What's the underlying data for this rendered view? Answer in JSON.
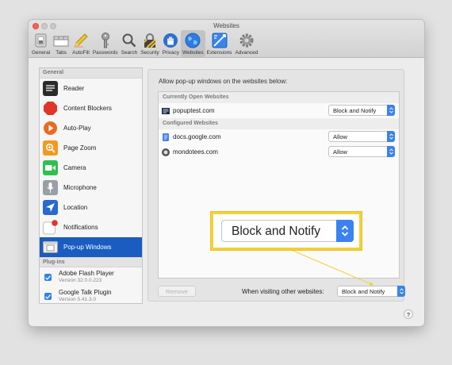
{
  "window": {
    "title": "Websites"
  },
  "toolbar": {
    "items": [
      {
        "label": "General",
        "icon": "switch-icon"
      },
      {
        "label": "Tabs",
        "icon": "tabs-icon"
      },
      {
        "label": "AutoFill",
        "icon": "pencil-icon"
      },
      {
        "label": "Passwords",
        "icon": "key-icon"
      },
      {
        "label": "Search",
        "icon": "magnifier-icon"
      },
      {
        "label": "Security",
        "icon": "padlock-icon"
      },
      {
        "label": "Privacy",
        "icon": "hand-icon"
      },
      {
        "label": "Websites",
        "icon": "globe-icon"
      },
      {
        "label": "Extensions",
        "icon": "puzzle-icon"
      },
      {
        "label": "Advanced",
        "icon": "gear-icon"
      }
    ],
    "active": "Websites"
  },
  "sidebar": {
    "general_header": "General",
    "items": [
      {
        "label": "Reader"
      },
      {
        "label": "Content Blockers"
      },
      {
        "label": "Auto-Play"
      },
      {
        "label": "Page Zoom"
      },
      {
        "label": "Camera"
      },
      {
        "label": "Microphone"
      },
      {
        "label": "Location"
      },
      {
        "label": "Notifications"
      },
      {
        "label": "Pop-up Windows"
      }
    ],
    "selected": "Pop-up Windows",
    "plugins_header": "Plug-ins",
    "plugins": [
      {
        "name": "Adobe Flash Player",
        "version": "Version 32.0.0.223"
      },
      {
        "name": "Google Talk Plugin",
        "version": "Version 5.41.3.0"
      }
    ]
  },
  "main": {
    "heading": "Allow pop-up windows on the websites below:",
    "currently_open_header": "Currently Open Websites",
    "currently_open": [
      {
        "site": "popuptest.com",
        "setting": "Block and Notify"
      }
    ],
    "configured_header": "Configured Websites",
    "configured": [
      {
        "site": "docs.google.com",
        "setting": "Allow"
      },
      {
        "site": "mondotees.com",
        "setting": "Allow"
      }
    ],
    "remove_label": "Remove",
    "visiting_label": "When visiting other websites:",
    "visiting_value": "Block and Notify"
  },
  "help_label": "?",
  "callout": {
    "value": "Block and Notify",
    "highlight_color": "#f4d03a"
  },
  "colors": {
    "selection": "#1a5cbf",
    "accent": "#3b82f0"
  }
}
